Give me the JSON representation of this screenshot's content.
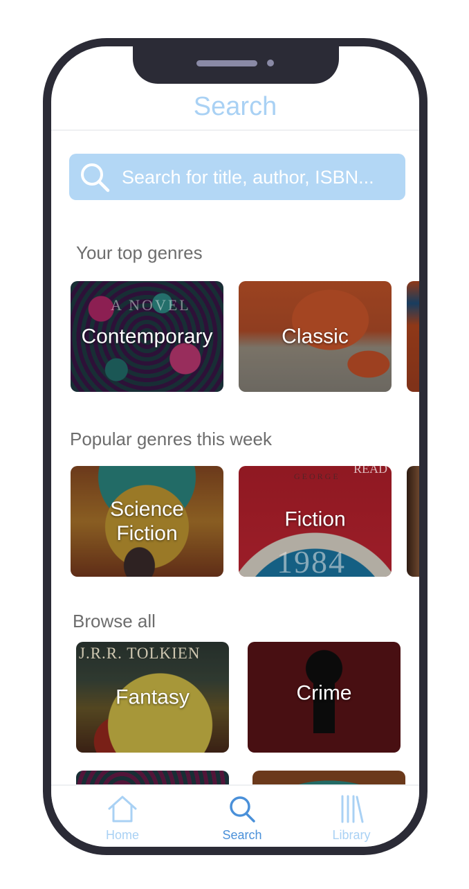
{
  "header": {
    "title": "Search"
  },
  "search": {
    "placeholder": "Search for title, author, ISBN..."
  },
  "sections": {
    "top_genres": {
      "title": "Your top genres",
      "items": [
        {
          "label": "Contemporary",
          "cover_text": "A NOVEL"
        },
        {
          "label": "Classic"
        }
      ]
    },
    "popular": {
      "title": "Popular genres this week",
      "items": [
        {
          "label": "Science\nFiction"
        },
        {
          "label": "Fiction",
          "cover_text_top": "GEORGE",
          "cover_text_badge": "READ",
          "cover_text_main": "1984"
        }
      ]
    },
    "browse": {
      "title": "Browse all",
      "items": [
        {
          "label": "Fantasy",
          "cover_text": "J.R.R. TOLKIEN"
        },
        {
          "label": "Crime"
        }
      ]
    }
  },
  "tabbar": {
    "home": "Home",
    "search": "Search",
    "library": "Library"
  },
  "colors": {
    "accent_light": "#a9d1f4",
    "accent_active": "#4a90d9",
    "search_bg": "#b3d7f5",
    "phone_frame": "#2b2b36"
  }
}
